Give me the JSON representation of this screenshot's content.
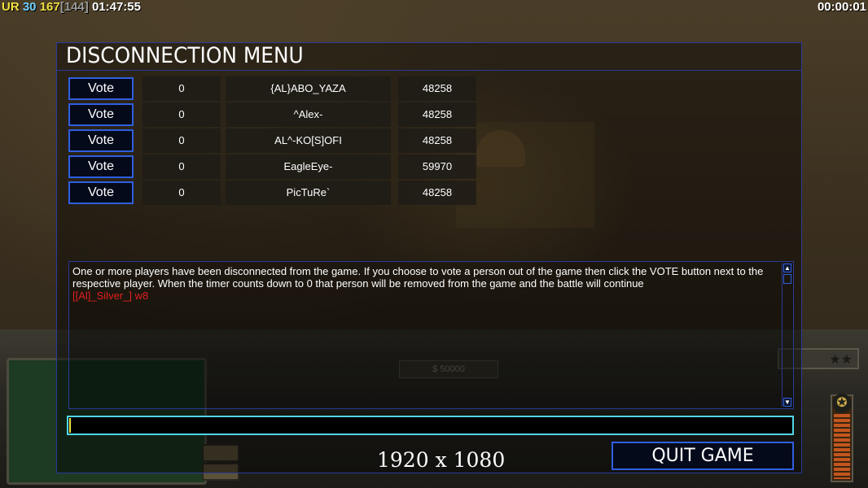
{
  "top_stats": {
    "label": "UR",
    "val1": "30",
    "val2": "167",
    "val3": "[144]",
    "clock": "01:47:55"
  },
  "timer": "00:00:01",
  "hud": {
    "money": "$ 50000",
    "rank_stars": "★★"
  },
  "dialog": {
    "title": "DISCONNECTION MENU",
    "players": [
      {
        "vote_label": "Vote",
        "votes": "0",
        "name": "{AL}ABO_YAZA",
        "ping": "48258"
      },
      {
        "vote_label": "Vote",
        "votes": "0",
        "name": "^Alex-",
        "ping": "48258"
      },
      {
        "vote_label": "Vote",
        "votes": "0",
        "name": "AL^-KO[S]OFI",
        "ping": "48258"
      },
      {
        "vote_label": "Vote",
        "votes": "0",
        "name": "EagleEye-",
        "ping": "59970"
      },
      {
        "vote_label": "Vote",
        "votes": "0",
        "name": "PicTuRe`",
        "ping": "48258"
      }
    ],
    "chat": {
      "message": "One or more players have been disconnected from the game. If you choose to vote a person out of the game then click the VOTE button next  to the respective player. When the timer counts down to 0 that person will be removed from the game and the battle will continue",
      "player_line": "[[Al]_Silver_] w8"
    },
    "input_value": "",
    "quit_label": "QUIT GAME"
  },
  "overlay_resolution": "1920 x 1080",
  "colors": {
    "frame_blue": "#2a3a9a",
    "button_border": "#2f5fe0",
    "input_border": "#4fd6e6",
    "chat_red": "#e02020"
  }
}
